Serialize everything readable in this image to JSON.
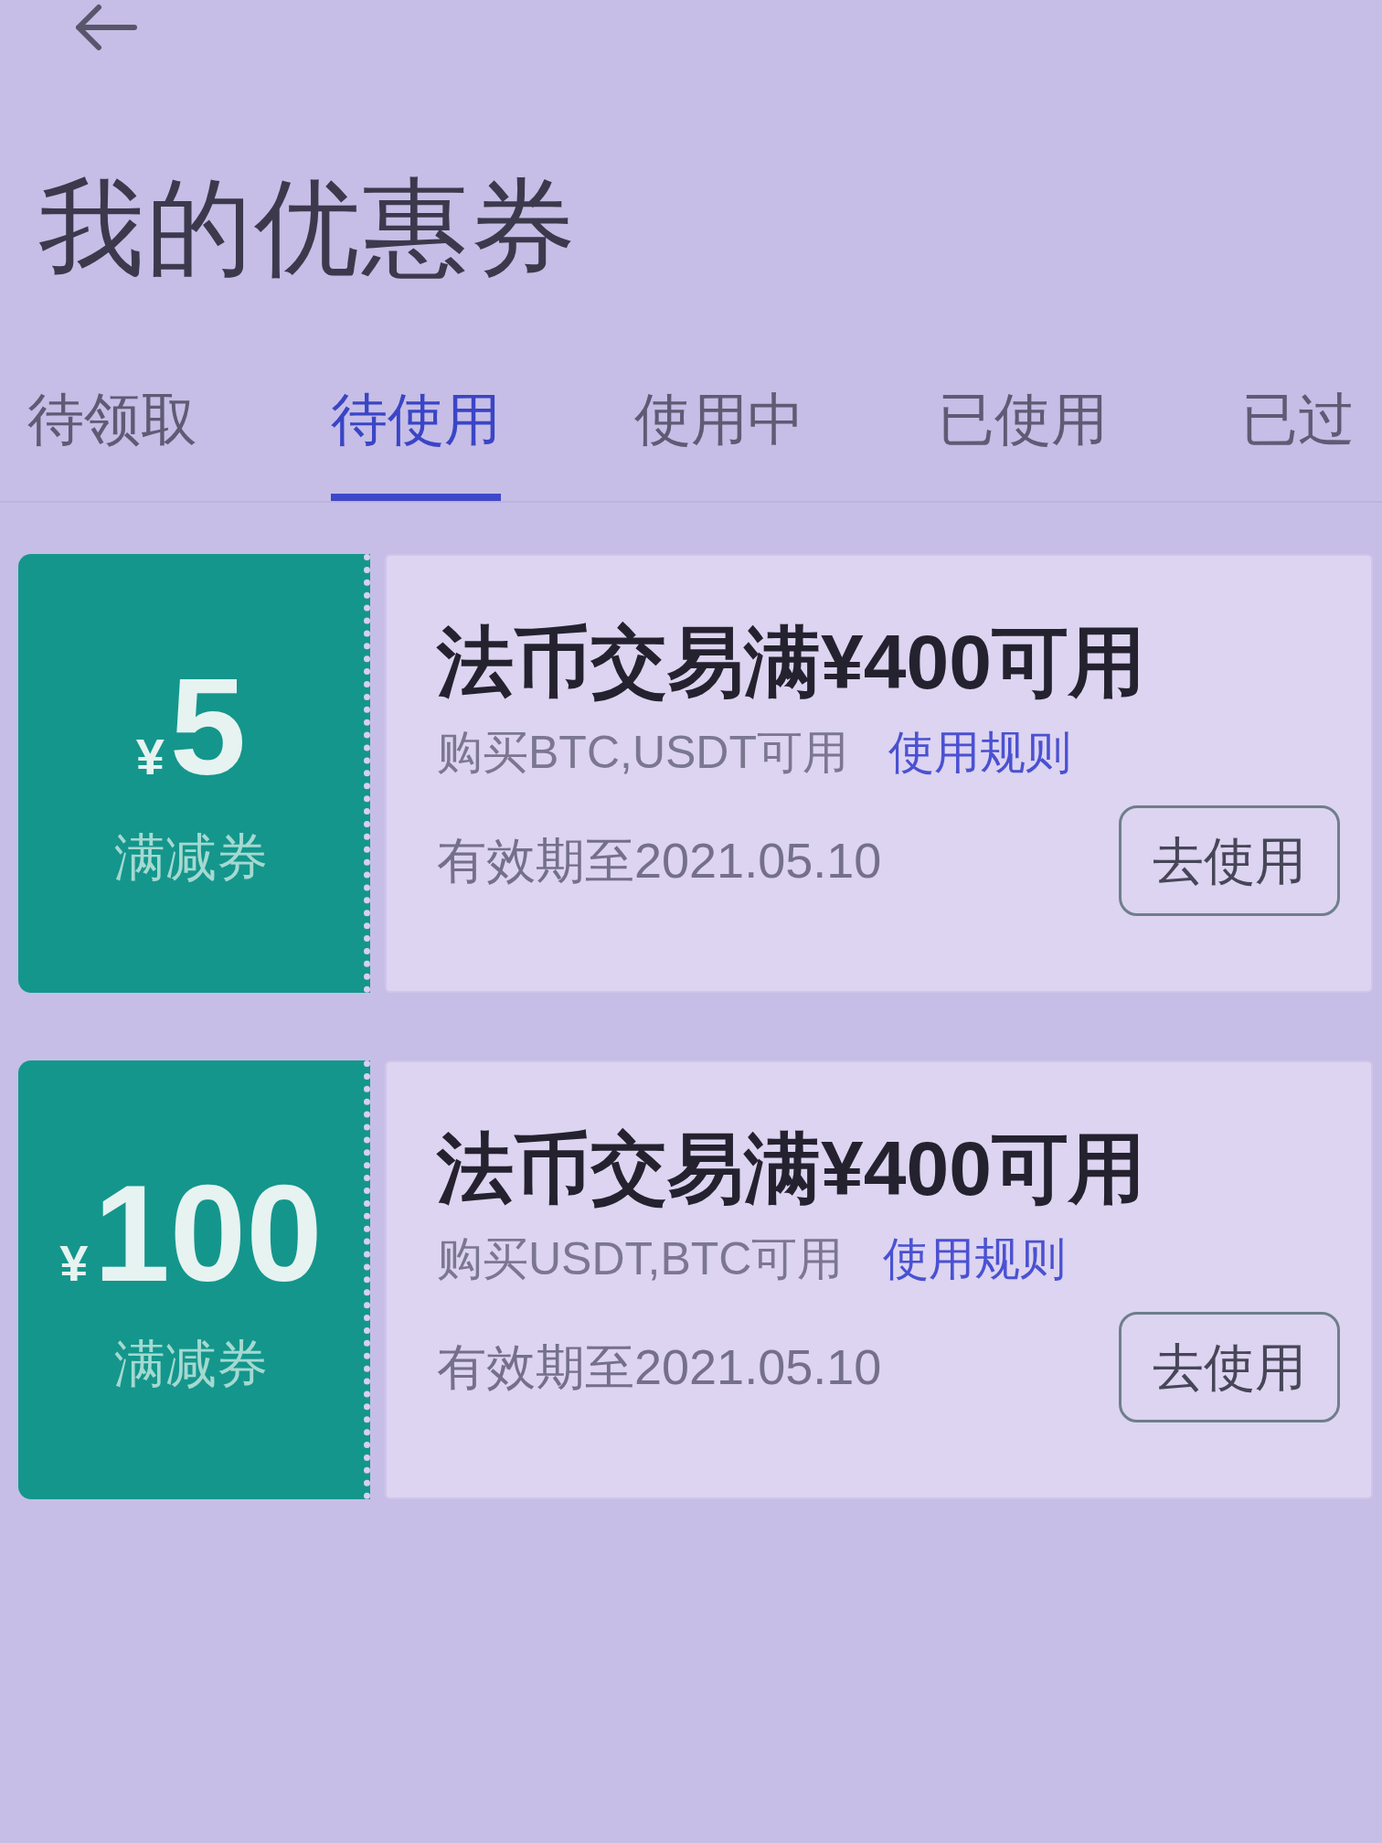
{
  "title": "我的优惠券",
  "tabs": [
    {
      "label": "待领取",
      "selected": false
    },
    {
      "label": "待使用",
      "selected": true
    },
    {
      "label": "使用中",
      "selected": false
    },
    {
      "label": "已使用",
      "selected": false
    },
    {
      "label": "已过",
      "selected": false
    }
  ],
  "coupons": [
    {
      "currency": "¥",
      "amount": "5",
      "coupon_type": "满减券",
      "title": "法币交易满¥400可用",
      "scope": "购买BTC,USDT可用",
      "rules_link": "使用规则",
      "validity": "有效期至2021.05.10",
      "action_button": "去使用"
    },
    {
      "currency": "¥",
      "amount": "100",
      "coupon_type": "满减券",
      "title": "法币交易满¥400可用",
      "scope": "购买USDT,BTC可用",
      "rules_link": "使用规则",
      "validity": "有效期至2021.05.10",
      "action_button": "去使用"
    }
  ]
}
